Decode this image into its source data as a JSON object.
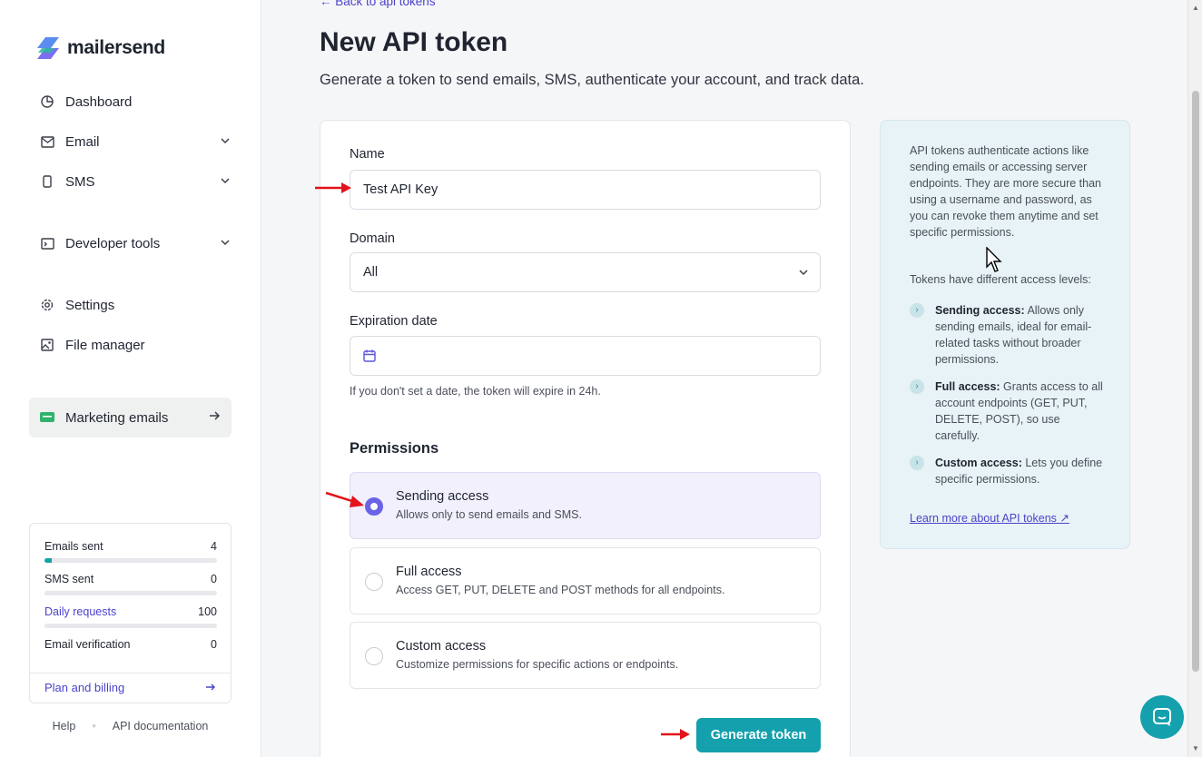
{
  "sidebar": {
    "logo_text": "mailersend",
    "items": [
      {
        "label": "Dashboard",
        "icon": "pie-chart-icon"
      },
      {
        "label": "Email",
        "icon": "envelope-icon"
      },
      {
        "label": "SMS",
        "icon": "phone-icon"
      },
      {
        "label": "Developer tools",
        "icon": "code-icon"
      },
      {
        "label": "Settings",
        "icon": "gear-icon"
      },
      {
        "label": "File manager",
        "icon": "image-icon"
      },
      {
        "label": "Marketing emails",
        "icon": "lite-badge-icon"
      }
    ],
    "usage": {
      "emails_sent_label": "Emails sent",
      "emails_sent_value": "4",
      "emails_sent_fraction": 0.04,
      "sms_sent_label": "SMS sent",
      "sms_sent_value": "0",
      "sms_sent_fraction": 0,
      "daily_requests_label": "Daily requests",
      "daily_requests_value": "100",
      "daily_requests_fraction": 0,
      "email_verification_label": "Email verification",
      "email_verification_value": "0",
      "email_verification_fraction": 0,
      "plan_label": "Plan and billing"
    },
    "footer": {
      "help": "Help",
      "api_docs": "API documentation"
    }
  },
  "main": {
    "back_link": "← Back to api tokens",
    "title": "New API token",
    "subtitle": "Generate a token to send emails, SMS, authenticate your account, and track data.",
    "form": {
      "name_label": "Name",
      "name_value": "Test API Key",
      "domain_label": "Domain",
      "domain_value": "All",
      "expiration_label": "Expiration date",
      "expiration_hint": "If you don't set a date, the token will expire in 24h.",
      "permissions_heading": "Permissions",
      "permissions": [
        {
          "title": "Sending access",
          "desc": "Allows only to send emails and SMS.",
          "selected": true
        },
        {
          "title": "Full access",
          "desc": "Access GET, PUT, DELETE and POST methods for all endpoints.",
          "selected": false
        },
        {
          "title": "Custom access",
          "desc": "Customize permissions for specific actions or endpoints.",
          "selected": false
        }
      ],
      "submit_label": "Generate token"
    },
    "info": {
      "intro": "API tokens authenticate actions like sending emails or accessing server endpoints. They are more secure than using a username and password, as you can revoke them anytime and set specific permissions.",
      "levels_intro": "Tokens have different access levels:",
      "levels": [
        {
          "name": "Sending access:",
          "text": " Allows only sending emails, ideal for email-related tasks without broader permissions."
        },
        {
          "name": "Full access:",
          "text": " Grants access to all account endpoints (GET, PUT, DELETE, POST), so use carefully."
        },
        {
          "name": "Custom access:",
          "text": " Lets you define specific permissions."
        }
      ],
      "learn_more": "Learn more about API tokens ↗"
    }
  },
  "colors": {
    "accent": "#14a0ad",
    "link": "#4a43c9",
    "radio_selected": "#6b63e6",
    "annotation_arrow": "#e3121b"
  }
}
